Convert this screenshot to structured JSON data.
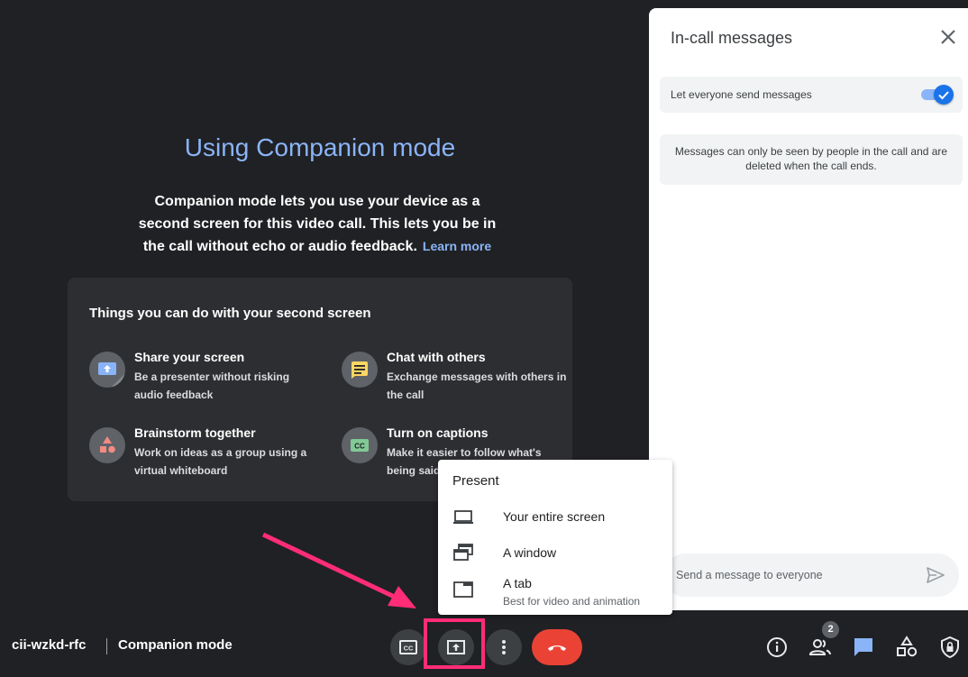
{
  "companion": {
    "title": "Using Companion mode",
    "description": "Companion mode lets you use your device as a second screen for this video call. This lets you be in the call without echo or audio feedback.",
    "learn_more": "Learn more",
    "card_title": "Things you can do with your second screen",
    "features": [
      {
        "icon": "share-screen-icon",
        "title": "Share your screen",
        "desc": "Be a presenter without risking audio feedback"
      },
      {
        "icon": "chat-icon",
        "title": "Chat with others",
        "desc": "Exchange messages with others in the call"
      },
      {
        "icon": "whiteboard-icon",
        "title": "Brainstorm together",
        "desc": "Work on ideas as a group using a virtual whiteboard"
      },
      {
        "icon": "captions-icon",
        "title": "Turn on captions",
        "desc": "Make it easier to follow what's being said"
      }
    ]
  },
  "panel": {
    "title": "In-call messages",
    "setting_label": "Let everyone send messages",
    "setting_enabled": true,
    "notice": "Messages can only be seen by people in the call and are deleted when the call ends.",
    "input_placeholder": "Send a message to everyone"
  },
  "present_menu": {
    "title": "Present",
    "items": [
      {
        "icon": "laptop-icon",
        "label": "Your entire screen",
        "sub": ""
      },
      {
        "icon": "window-icon",
        "label": "A window",
        "sub": ""
      },
      {
        "icon": "tab-icon",
        "label": "A tab",
        "sub": "Best for video and animation"
      }
    ]
  },
  "bottom_bar": {
    "meeting_code": "cii-wzkd-rfc",
    "meeting_name": "Companion mode",
    "participant_count": "2"
  },
  "colors": {
    "background": "#202124",
    "accent_blue": "#8ab4f8",
    "hangup_red": "#ea4335",
    "highlight_pink": "#ff2d75"
  }
}
